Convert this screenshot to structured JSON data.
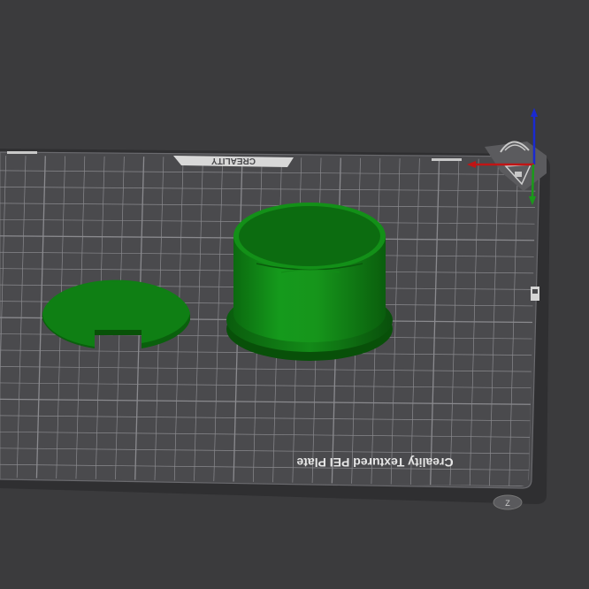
{
  "viewport": {
    "background": "#3b3b3d"
  },
  "build_plate": {
    "brand_label": "CREALITY",
    "plate_label": "Creality Textured PEI Plate",
    "plate_color": "#4a4a4d",
    "grid_color": "#8a8a8e",
    "label_color": "#e6e6e6"
  },
  "models": [
    {
      "name": "slotted-disc",
      "color": "#0e7a12"
    },
    {
      "name": "cup-with-flange",
      "color": "#117a15"
    }
  ],
  "axes": {
    "x_color": "#c01515",
    "y_color": "#1a9a1a",
    "z_color": "#1a2ad0"
  }
}
